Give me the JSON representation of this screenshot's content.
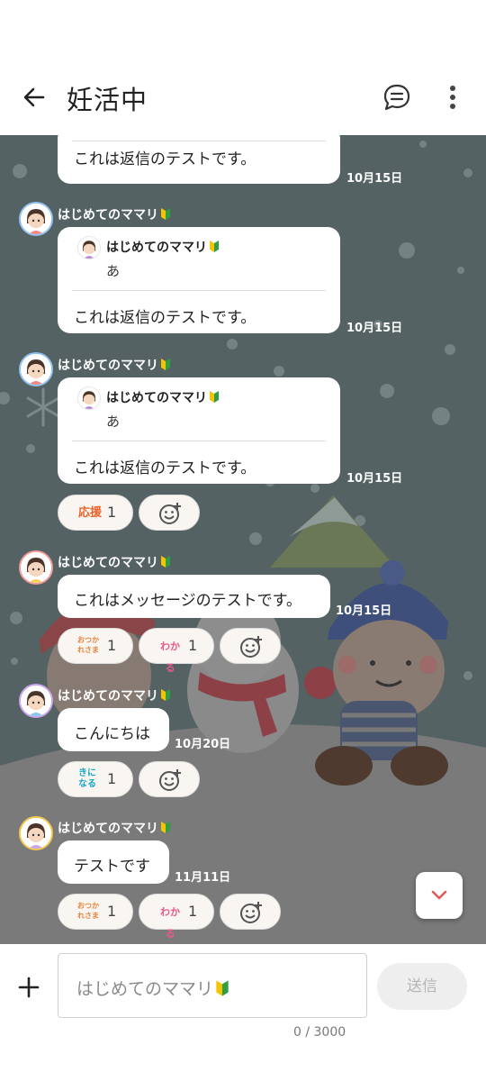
{
  "header": {
    "title": "妊活中",
    "back_icon": "arrow-left-icon",
    "thread_icon": "chat-thread-icon",
    "more_icon": "more-vertical-icon"
  },
  "colors": {
    "chat_background": "#546263",
    "bubble": "#ffffff",
    "send_disabled": "#eeeeee",
    "accent_red": "#e05b5b"
  },
  "messages": [
    {
      "name": "",
      "text": "これは返信のテストです。",
      "time": "10月15日"
    },
    {
      "name": "はじめてのママリ",
      "quote_name": "はじめてのママリ",
      "quote_text": "あ",
      "text": "これは返信のテストです。",
      "time": "10月15日"
    },
    {
      "name": "はじめてのママリ",
      "quote_name": "はじめてのママリ",
      "quote_text": "あ",
      "text": "これは返信のテストです。",
      "time": "10月15日",
      "reactions": [
        {
          "stamp": "応援",
          "count": "1"
        }
      ]
    },
    {
      "name": "はじめてのママリ",
      "text": "これはメッセージのテストです。",
      "time": "10月15日",
      "reactions": [
        {
          "stamp": "おつかれさま",
          "count": "1"
        },
        {
          "stamp": "わかる",
          "count": "1"
        }
      ]
    },
    {
      "name": "はじめてのママリ",
      "text": "こんにちは",
      "time": "10月20日",
      "reactions": [
        {
          "stamp": "きになる",
          "count": "1"
        }
      ]
    },
    {
      "name": "はじめてのママリ",
      "text": "テストです",
      "time": "11月11日",
      "reactions": [
        {
          "stamp": "おつかれさま",
          "count": "1"
        },
        {
          "stamp": "わかる",
          "count": "1"
        }
      ]
    }
  ],
  "composer": {
    "placeholder": "はじめてのママリ",
    "send_label": "送信",
    "counter": "0 / 3000"
  }
}
